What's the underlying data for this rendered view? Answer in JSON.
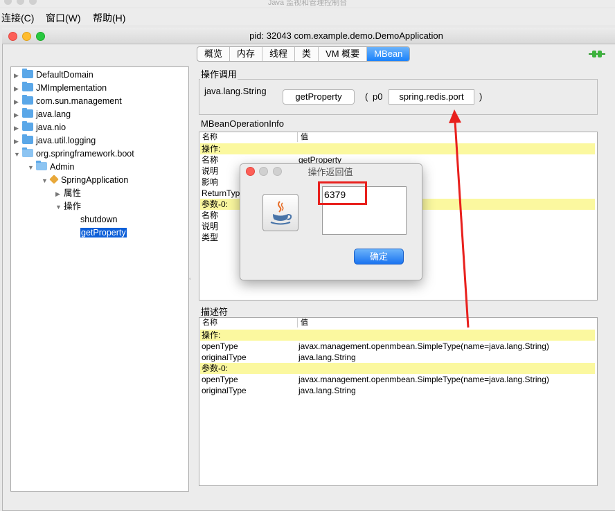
{
  "outer_window": {
    "title": "Java 监视和管理控制台"
  },
  "menu": {
    "items": [
      "连接(C)",
      "窗口(W)",
      "帮助(H)"
    ]
  },
  "window": {
    "title": "pid: 32043 com.example.demo.DemoApplication"
  },
  "tabs": [
    "概览",
    "内存",
    "线程",
    "类",
    "VM 概要",
    "MBean"
  ],
  "active_tab": "MBean",
  "tree": {
    "items": [
      {
        "label": "DefaultDomain",
        "icon": "folder-icon"
      },
      {
        "label": "JMImplementation",
        "icon": "folder-icon"
      },
      {
        "label": "com.sun.management",
        "icon": "folder-icon"
      },
      {
        "label": "java.lang",
        "icon": "folder-icon"
      },
      {
        "label": "java.nio",
        "icon": "folder-icon"
      },
      {
        "label": "java.util.logging",
        "icon": "folder-icon"
      },
      {
        "label": "org.springframework.boot",
        "icon": "folder-open-icon"
      },
      {
        "label": "Admin",
        "icon": "folder-open-icon"
      },
      {
        "label": "SpringApplication",
        "icon": "bean-icon"
      },
      {
        "label": "属性"
      },
      {
        "label": "操作"
      },
      {
        "label": "shutdown"
      },
      {
        "label": "getProperty",
        "selected": true
      }
    ]
  },
  "operation": {
    "group_label": "操作调用",
    "return_type": "java.lang.String",
    "button_label": "getProperty",
    "open_paren": "(",
    "param_label": "p0",
    "param_value": "spring.redis.port",
    "close_paren": ")"
  },
  "mbean_info": {
    "group_label": "MBeanOperationInfo",
    "columns": [
      "名称",
      "值"
    ],
    "rows": [
      {
        "name": "操作:",
        "value": "",
        "highlight": true
      },
      {
        "name": "名称",
        "value": "getProperty"
      },
      {
        "name": "说明",
        "value": ""
      },
      {
        "name": "影响",
        "value": ""
      },
      {
        "name": "ReturnTyp",
        "value": ""
      },
      {
        "name": "参数-0:",
        "value": "",
        "highlight": true
      },
      {
        "name": "名称",
        "value": ""
      },
      {
        "name": "说明",
        "value": ""
      },
      {
        "name": "类型",
        "value": ""
      }
    ]
  },
  "descriptor": {
    "group_label": "描述符",
    "columns": [
      "名称",
      "值"
    ],
    "rows": [
      {
        "name": "操作:",
        "value": "",
        "highlight": true
      },
      {
        "name": "openType",
        "value": "javax.management.openmbean.SimpleType(name=java.lang.String)"
      },
      {
        "name": "originalType",
        "value": "java.lang.String"
      },
      {
        "name": "参数-0:",
        "value": "",
        "highlight": true
      },
      {
        "name": "openType",
        "value": "javax.management.openmbean.SimpleType(name=java.lang.String)"
      },
      {
        "name": "originalType",
        "value": "java.lang.String"
      }
    ]
  },
  "dialog": {
    "title": "操作返回值",
    "result": "6379",
    "ok_label": "确定",
    "icon": "java-cup-icon"
  },
  "annotation": {
    "color": "#e8201d"
  }
}
